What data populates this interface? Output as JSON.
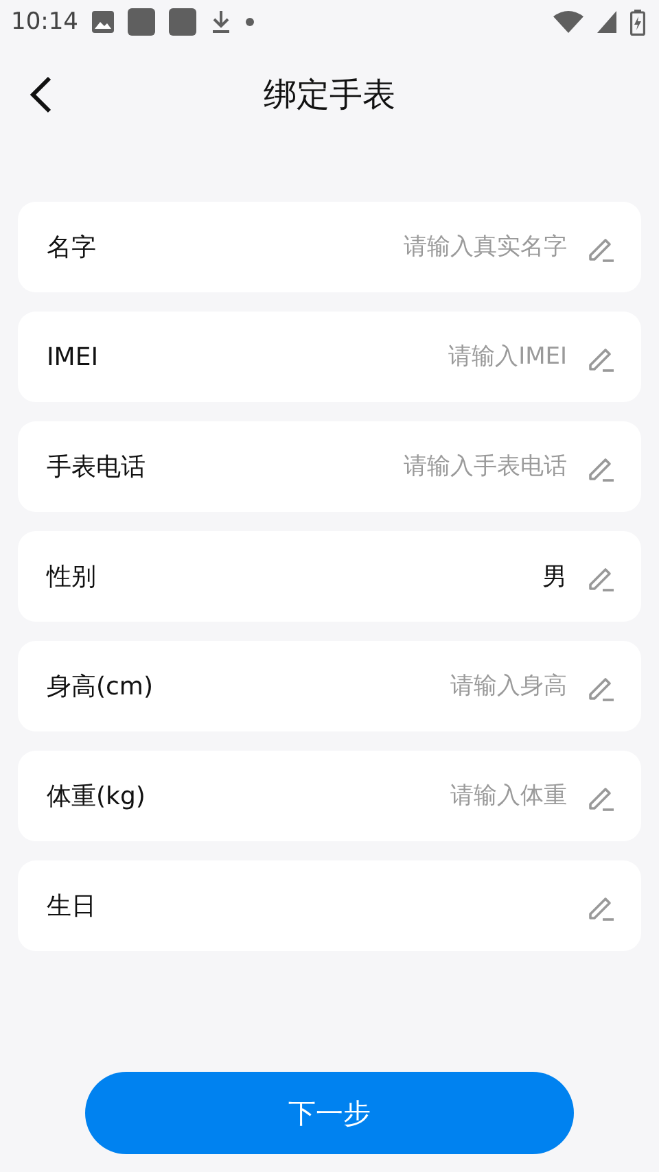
{
  "status_bar": {
    "time": "10:14"
  },
  "header": {
    "title": "绑定手表"
  },
  "fields": [
    {
      "label": "名字",
      "placeholder": "请输入真实名字"
    },
    {
      "label": "IMEI",
      "placeholder": "请输入IMEI"
    },
    {
      "label": "手表电话",
      "placeholder": "请输入手表电话"
    },
    {
      "label": "性别",
      "value": "男"
    },
    {
      "label": "身高(cm)",
      "placeholder": "请输入身高"
    },
    {
      "label": "体重(kg)",
      "placeholder": "请输入体重"
    },
    {
      "label": "生日"
    }
  ],
  "next_button": "下一步"
}
